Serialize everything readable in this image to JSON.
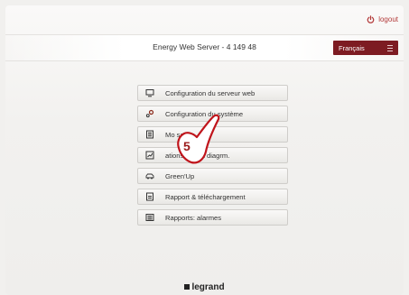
{
  "topbar": {
    "logout_label": "logout"
  },
  "header": {
    "title": "Energy Web Server - 4 149 48",
    "language": "Français"
  },
  "menu": {
    "items": [
      {
        "label": "Configuration du serveur web",
        "icon": "monitor-icon"
      },
      {
        "label": "Configuration du système",
        "icon": "gears-icon"
      },
      {
        "label": "Mo  sation",
        "icon": "list-icon"
      },
      {
        "label": "  ations: info & diagrm.",
        "icon": "chart-icon"
      },
      {
        "label": "Green'Up",
        "icon": "car-icon"
      },
      {
        "label": "Rapport & téléchargement",
        "icon": "report-icon"
      },
      {
        "label": "Rapports: alarmes",
        "icon": "alarm-report-icon"
      }
    ]
  },
  "annotation": {
    "step_number": "5"
  },
  "footer": {
    "brand": "legrand"
  },
  "colors": {
    "accent": "#7d1b22",
    "logout": "#b33a3a"
  }
}
